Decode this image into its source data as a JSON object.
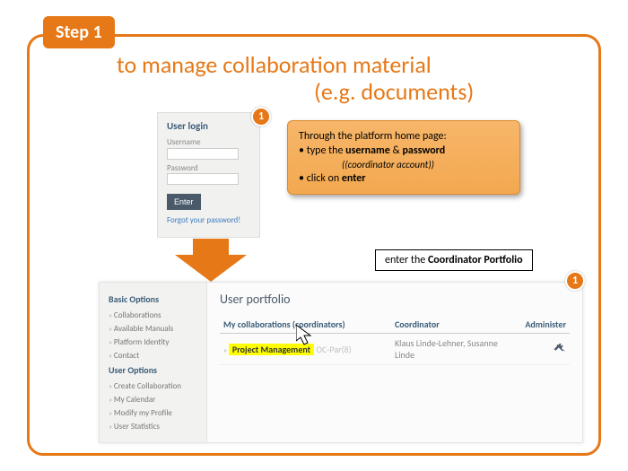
{
  "step": {
    "label": "Step 1"
  },
  "title": {
    "line1": "to manage collaboration material",
    "line2": "(e.g. documents)"
  },
  "marker": {
    "one": "1"
  },
  "login": {
    "heading": "User login",
    "username_label": "Username",
    "password_label": "Password",
    "enter_label": "Enter",
    "forgot": "Forgot your password!"
  },
  "callout": {
    "intro": "Through the platform home page:",
    "b1_prefix": "• type the ",
    "b1_bold1": "username",
    "b1_mid": " & ",
    "b1_bold2": "password",
    "b1_sub": "(coordinator account)",
    "b2_prefix": "• click on ",
    "b2_bold": "enter"
  },
  "enterbox": {
    "prefix": "enter the ",
    "bold": "Coordinator Portfolio"
  },
  "sidebar": {
    "section1": "Basic Options",
    "items1": [
      "Collaborations",
      "Available Manuals",
      "Platform Identity",
      "Contact"
    ],
    "section2": "User Options",
    "items2": [
      "Create Collaboration",
      "My Calendar",
      "Modify my Profile",
      "User Statistics"
    ]
  },
  "portfolio": {
    "title": "User portfolio",
    "col1": "My collaborations (coordinators)",
    "col2": "Coordinator",
    "col3": "Administer",
    "row": {
      "highlight": "Project Management",
      "tail": "OC-Par(8)",
      "coord": "Klaus Linde-Lehner, Susanne Linde"
    }
  }
}
